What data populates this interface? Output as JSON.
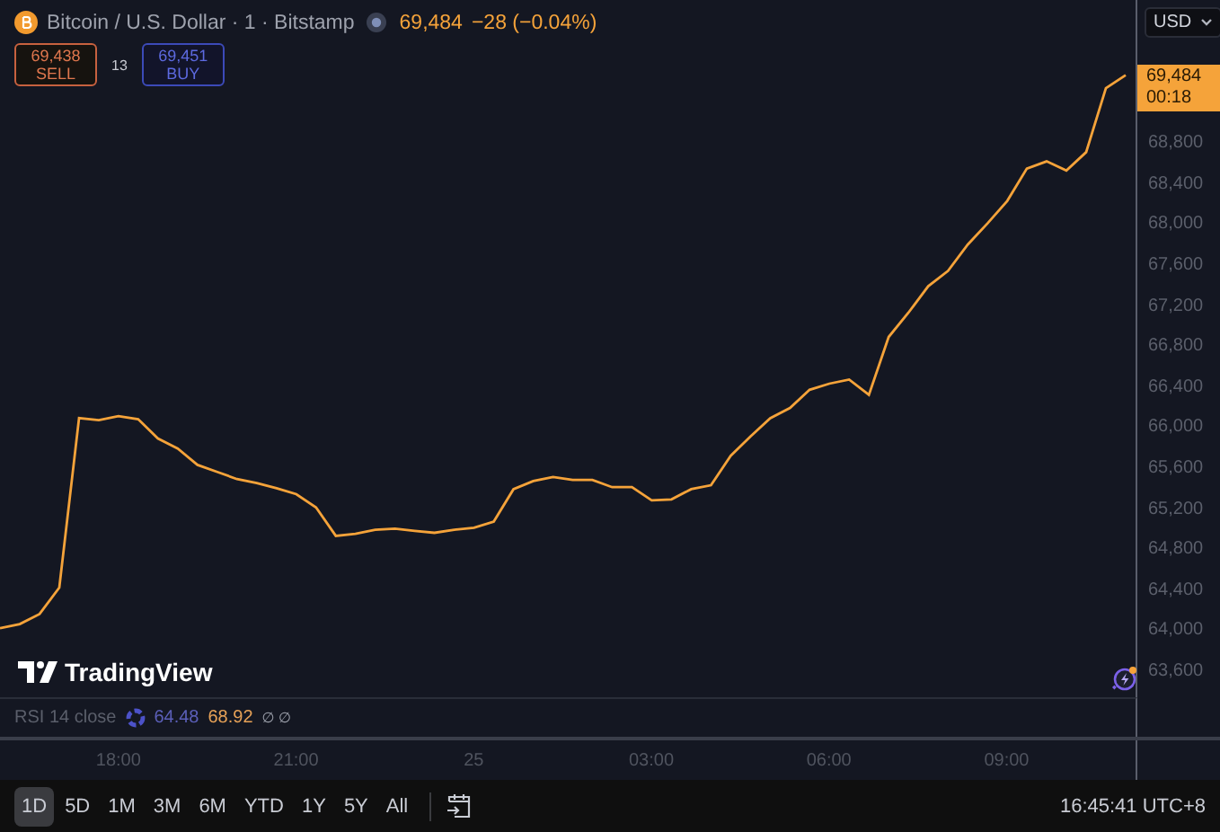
{
  "header": {
    "symbol": "Bitcoin / U.S. Dollar · 1 · Bitstamp",
    "last_price": "69,484",
    "change": "−28 (−0.04%)"
  },
  "trade": {
    "sell_price": "69,438",
    "sell_label": "SELL",
    "spread": "13",
    "buy_price": "69,451",
    "buy_label": "BUY"
  },
  "currency": "USD",
  "price_label": {
    "price": "69,484",
    "countdown": "00:18"
  },
  "chart_data": {
    "type": "line",
    "ylim": [
      63350,
      70220
    ],
    "categories": [
      null,
      null,
      null,
      null,
      null,
      null,
      "18:00",
      null,
      null,
      null,
      null,
      null,
      null,
      null,
      null,
      "21:00",
      null,
      null,
      null,
      null,
      null,
      null,
      null,
      null,
      "25",
      null,
      null,
      null,
      null,
      null,
      null,
      null,
      null,
      "03:00",
      null,
      null,
      null,
      null,
      null,
      null,
      null,
      null,
      "06:00",
      null,
      null,
      null,
      null,
      null,
      null,
      null,
      null,
      "09:00",
      null,
      null,
      null,
      null,
      null,
      null
    ],
    "yticks": [
      {
        "value": 63600,
        "label": "63,600"
      },
      {
        "value": 64000,
        "label": "64,000"
      },
      {
        "value": 64400,
        "label": "64,400"
      },
      {
        "value": 64800,
        "label": "64,800"
      },
      {
        "value": 65200,
        "label": "65,200"
      },
      {
        "value": 65600,
        "label": "65,600"
      },
      {
        "value": 66000,
        "label": "66,000"
      },
      {
        "value": 66400,
        "label": "66,400"
      },
      {
        "value": 66800,
        "label": "66,800"
      },
      {
        "value": 67200,
        "label": "67,200"
      },
      {
        "value": 67600,
        "label": "67,600"
      },
      {
        "value": 68000,
        "label": "68,000"
      },
      {
        "value": 68400,
        "label": "68,400"
      },
      {
        "value": 68800,
        "label": "68,800"
      }
    ],
    "series": [
      {
        "color": "#f5a33a",
        "values": [
          64030,
          64070,
          64170,
          64430,
          66100,
          66080,
          66120,
          66090,
          65900,
          65800,
          65640,
          65570,
          65500,
          65460,
          65410,
          65350,
          65220,
          64940,
          64960,
          65000,
          65010,
          64990,
          64970,
          65000,
          65020,
          65080,
          65400,
          65480,
          65520,
          65490,
          65490,
          65420,
          65420,
          65290,
          65300,
          65400,
          65440,
          65730,
          65920,
          66100,
          66200,
          66380,
          66440,
          66480,
          66330,
          66900,
          67140,
          67400,
          67550,
          67810,
          68020,
          68240,
          68560,
          68630,
          68540,
          68720,
          69350,
          69480
        ]
      }
    ]
  },
  "logo": "TradingView",
  "rsi": {
    "label": "RSI 14 close",
    "value_1": "64.48",
    "value_2": "68.92",
    "extra": "∅ ∅"
  },
  "ranges": [
    {
      "label": "1D",
      "selected": true
    },
    {
      "label": "5D",
      "selected": false
    },
    {
      "label": "1M",
      "selected": false
    },
    {
      "label": "3M",
      "selected": false
    },
    {
      "label": "6M",
      "selected": false
    },
    {
      "label": "YTD",
      "selected": false
    },
    {
      "label": "1Y",
      "selected": false
    },
    {
      "label": "5Y",
      "selected": false
    },
    {
      "label": "All",
      "selected": false
    }
  ],
  "clock": "16:45:41 UTC+8"
}
